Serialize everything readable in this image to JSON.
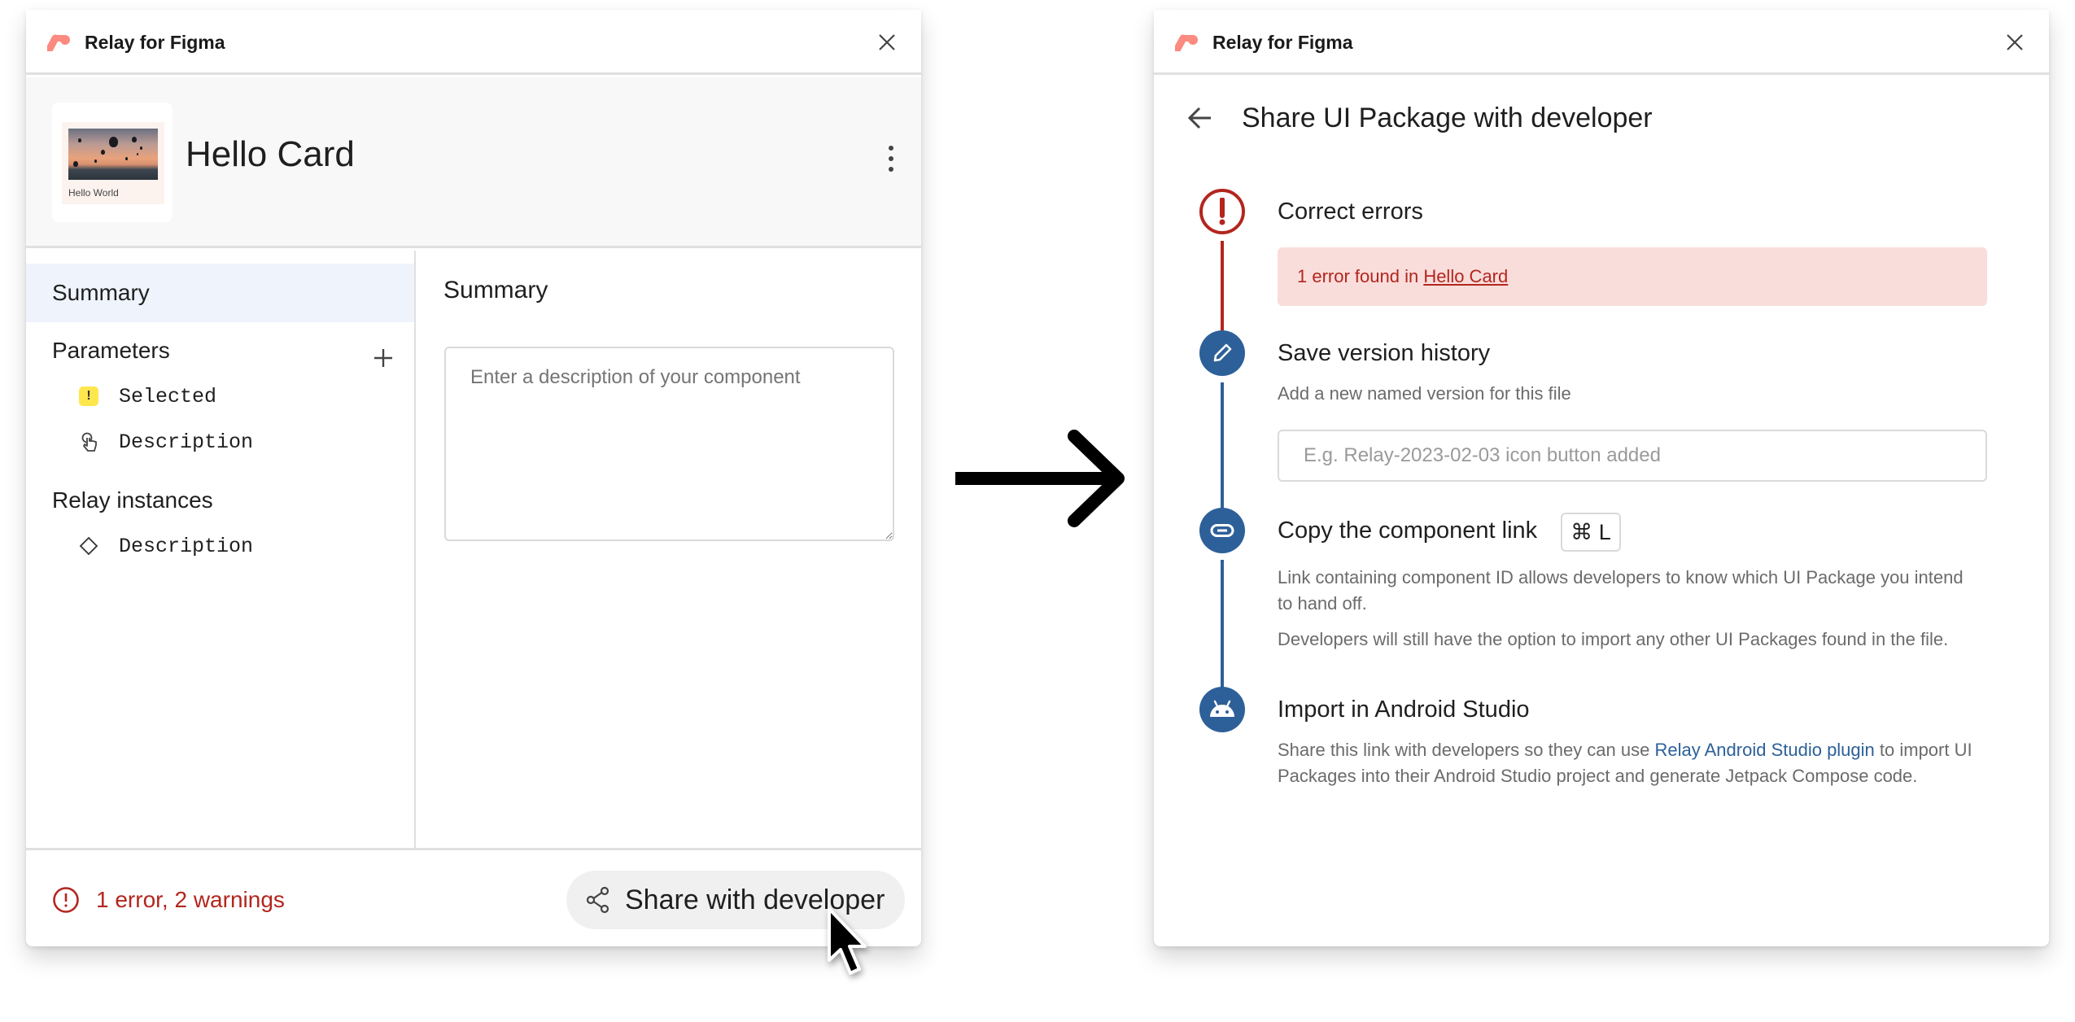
{
  "left_panel": {
    "app_title": "Relay for Figma",
    "component": {
      "name": "Hello Card",
      "thumbnail_label": "Hello World"
    },
    "sidebar": {
      "summary_label": "Summary",
      "parameters_heading": "Parameters",
      "parameters": [
        {
          "label": "Selected",
          "icon": "warning-badge-icon"
        },
        {
          "label": "Description",
          "icon": "touch-icon"
        }
      ],
      "relay_instances_heading": "Relay instances",
      "relay_instances": [
        {
          "label": "Description",
          "icon": "diamond-icon"
        }
      ]
    },
    "main": {
      "title": "Summary",
      "description_placeholder": "Enter a description of your component",
      "description_value": ""
    },
    "footer": {
      "status_text": "1 error, 2 warnings",
      "share_button_label": "Share with developer"
    }
  },
  "right_panel": {
    "app_title": "Relay for Figma",
    "page_title": "Share UI Package with developer",
    "steps": [
      {
        "title": "Correct errors",
        "status": "error",
        "icon": "error-icon",
        "banner_prefix": "1 error found in ",
        "banner_link": "Hello Card"
      },
      {
        "title": "Save version history",
        "icon": "pencil-icon",
        "description": "Add a new named version for this file",
        "input_placeholder": "E.g. Relay-2023-02-03 icon button added",
        "input_value": ""
      },
      {
        "title": "Copy the component link",
        "icon": "link-icon",
        "shortcut": "⌘ L",
        "description_1": "Link containing component ID allows developers to know which UI Package you intend to hand off.",
        "description_2": "Developers will still have the option to import any other UI Packages found in the file."
      },
      {
        "title": "Import in Android Studio",
        "icon": "android-icon",
        "description_prefix": "Share this link with developers so they can use ",
        "description_link": "Relay Android Studio plugin",
        "description_suffix": " to import UI Packages into their Android Studio project and generate Jetpack Compose code."
      }
    ]
  },
  "colors": {
    "error": "#b3261e",
    "error_bg": "#f9dddb",
    "accent_blue": "#2d6099",
    "logo": "#fb8a80",
    "selected_bg": "#eff3fb",
    "warning_badge": "#fde74c"
  }
}
